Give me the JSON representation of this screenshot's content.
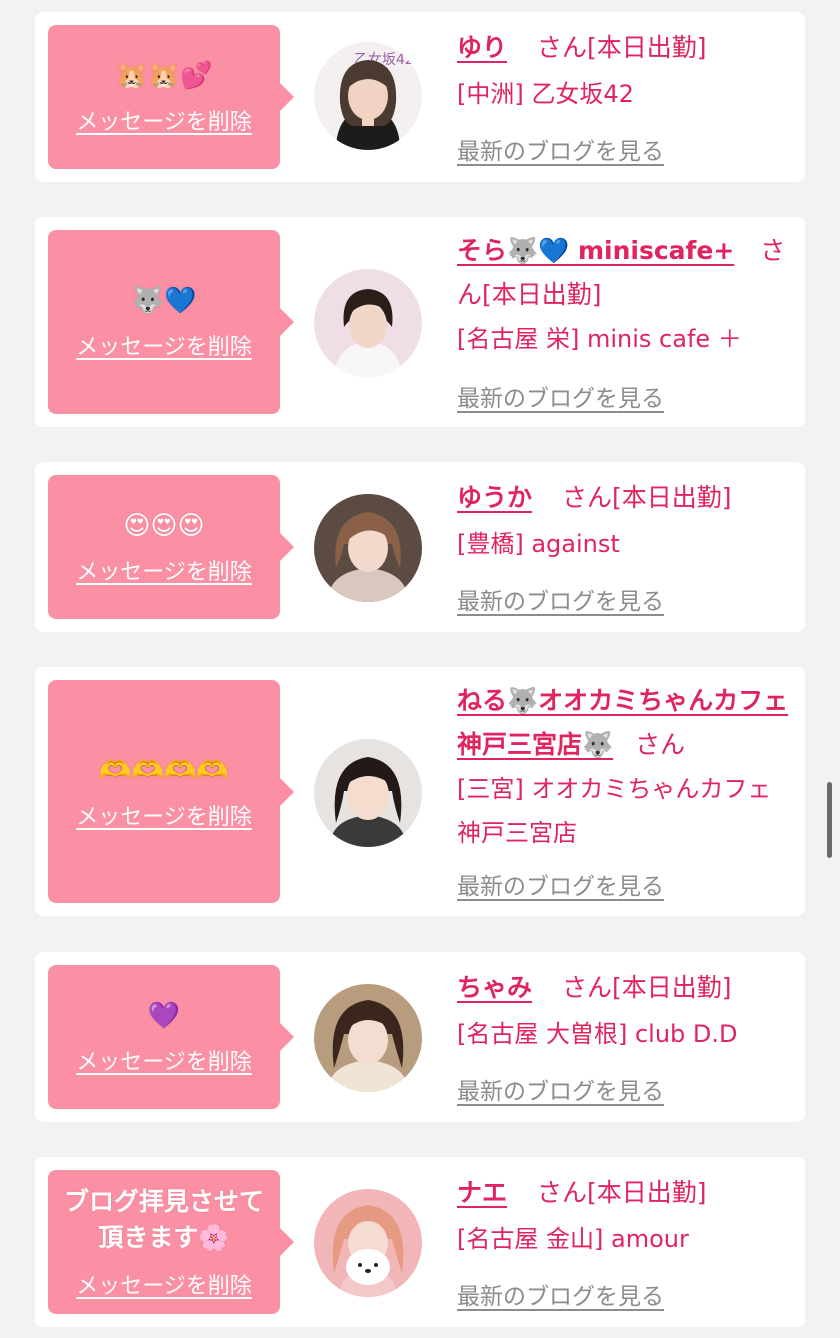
{
  "common": {
    "delete_label": "メッセージを削除",
    "blog_label": "最新のブログを見る",
    "san_suffix": "さん"
  },
  "colors": {
    "bubble": "#fb8fa4",
    "name": "#e0245e",
    "link_gray": "#8c8c8c",
    "page_bg": "#f2f2f2"
  },
  "entries": [
    {
      "message": "🐹🐹💕",
      "name": "ゆり",
      "status": "[本日出勤]",
      "shop": "[中洲] 乙女坂42",
      "avatar_icon": "profile-photo"
    },
    {
      "message": "🐺💙",
      "name": "そら🐺💙 miniscafe+",
      "status": "[本日出勤]",
      "shop": "[名古屋 栄] minis cafe ＋",
      "avatar_icon": "profile-photo"
    },
    {
      "message": "😍😍😍",
      "name": "ゆうか",
      "status": "[本日出勤]",
      "shop": "[豊橋] against",
      "avatar_icon": "profile-photo"
    },
    {
      "message": "🫶🫶🫶🫶",
      "name": "ねる🐺オオカミちゃんカフェ神戸三宮店🐺",
      "status": "",
      "shop": "[三宮] オオカミちゃんカフェ神戸三宮店",
      "avatar_icon": "profile-photo"
    },
    {
      "message": "💜",
      "name": "ちゃみ",
      "status": "[本日出勤]",
      "shop": "[名古屋 大曽根] club D.D",
      "avatar_icon": "profile-photo"
    },
    {
      "message": "ブログ拝見させて頂きます🌸",
      "name": "ナエ",
      "status": "[本日出勤]",
      "shop": "[名古屋 金山] amour",
      "avatar_icon": "profile-photo"
    }
  ]
}
